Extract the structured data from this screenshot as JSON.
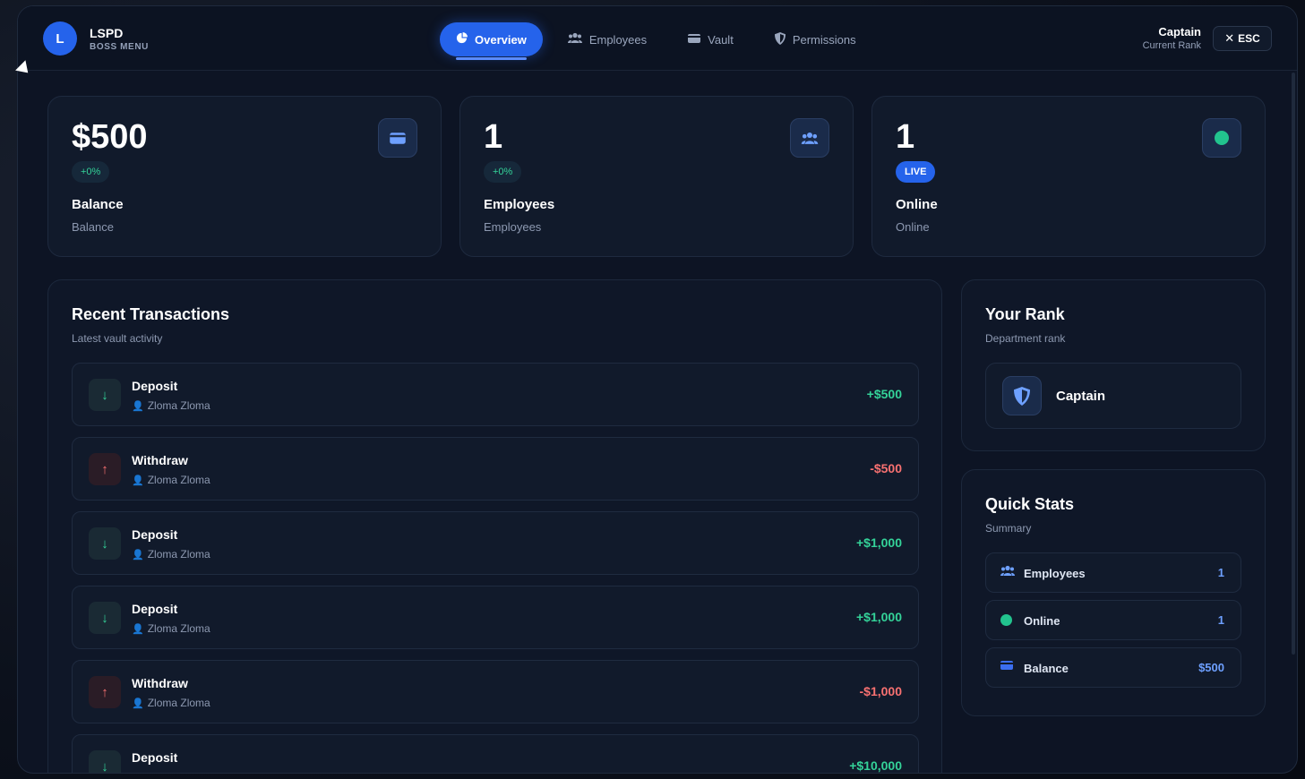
{
  "brand": {
    "initial": "L",
    "name": "LSPD",
    "subtitle": "BOSS MENU"
  },
  "nav": [
    {
      "label": "Overview",
      "icon": "pie-chart-icon",
      "active": true
    },
    {
      "label": "Employees",
      "icon": "users-icon",
      "active": false
    },
    {
      "label": "Vault",
      "icon": "wallet-icon",
      "active": false
    },
    {
      "label": "Permissions",
      "icon": "shield-icon",
      "active": false
    }
  ],
  "user": {
    "rank": "Captain",
    "rank_caption": "Current Rank"
  },
  "esc": {
    "label": "ESC",
    "icon": "close-icon"
  },
  "stats": [
    {
      "value": "$500",
      "badge": "+0%",
      "label": "Balance",
      "sub": "Balance",
      "icon": "wallet-icon"
    },
    {
      "value": "1",
      "badge": "+0%",
      "label": "Employees",
      "sub": "Employees",
      "icon": "users-icon"
    },
    {
      "value": "1",
      "badge": "LIVE",
      "label": "Online",
      "sub": "Online",
      "icon": "status-dot-icon"
    }
  ],
  "transactions": {
    "title": "Recent Transactions",
    "subtitle": "Latest vault activity",
    "items": [
      {
        "type": "Deposit",
        "user": "Zloma Zloma",
        "amount": "+$500",
        "direction": "in"
      },
      {
        "type": "Withdraw",
        "user": "Zloma Zloma",
        "amount": "-$500",
        "direction": "out"
      },
      {
        "type": "Deposit",
        "user": "Zloma Zloma",
        "amount": "+$1,000",
        "direction": "in"
      },
      {
        "type": "Deposit",
        "user": "Zloma Zloma",
        "amount": "+$1,000",
        "direction": "in"
      },
      {
        "type": "Withdraw",
        "user": "Zloma Zloma",
        "amount": "-$1,000",
        "direction": "out"
      },
      {
        "type": "Deposit",
        "user": "",
        "amount": "+$10,000",
        "direction": "in"
      }
    ]
  },
  "rank_panel": {
    "title": "Your Rank",
    "subtitle": "Department rank",
    "rank": "Captain",
    "icon": "shield-icon"
  },
  "quick_stats": {
    "title": "Quick Stats",
    "subtitle": "Summary",
    "rows": [
      {
        "label": "Employees",
        "value": "1",
        "icon": "users-icon"
      },
      {
        "label": "Online",
        "value": "1",
        "icon": "status-dot-icon"
      },
      {
        "label": "Balance",
        "value": "$500",
        "icon": "wallet-icon"
      }
    ]
  },
  "colors": {
    "accent": "#2563eb",
    "positive": "#34d399",
    "negative": "#f87171",
    "background": "#0d1424"
  }
}
